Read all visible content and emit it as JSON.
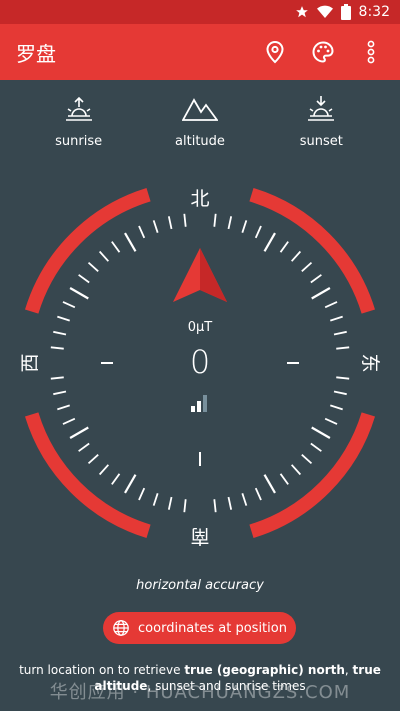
{
  "status_bar": {
    "time": "8:32",
    "icons": [
      "star-icon",
      "wifi-icon",
      "battery-icon"
    ]
  },
  "app_bar": {
    "title": "罗盘",
    "actions": [
      "location-pin-icon",
      "palette-icon",
      "more-vert-icon"
    ]
  },
  "quick_actions": [
    {
      "label": "sunrise",
      "icon": "sunrise-icon"
    },
    {
      "label": "altitude",
      "icon": "mountains-icon"
    },
    {
      "label": "sunset",
      "icon": "sunset-icon"
    }
  ],
  "compass": {
    "directions": {
      "north": "北",
      "east": "东",
      "south": "南",
      "west": "西"
    },
    "field_strength": "0µT",
    "heading": "0"
  },
  "accuracy_label": "horizontal accuracy",
  "coordinates_button": {
    "label": "coordinates at position",
    "icon": "globe-icon"
  },
  "hint": {
    "text1": "turn location on to retrieve ",
    "bold1": "true (geographic) north",
    "text2": ", ",
    "bold2": "true altitude",
    "text3": ", sunset and sunrise times"
  },
  "watermark": "华创应用 · HUACHUANGZS.COM",
  "colors": {
    "status_bar": "#c62828",
    "app_bar": "#e53935",
    "background": "#37474f",
    "ring": "#e53935",
    "ticks": "#ffffff"
  }
}
